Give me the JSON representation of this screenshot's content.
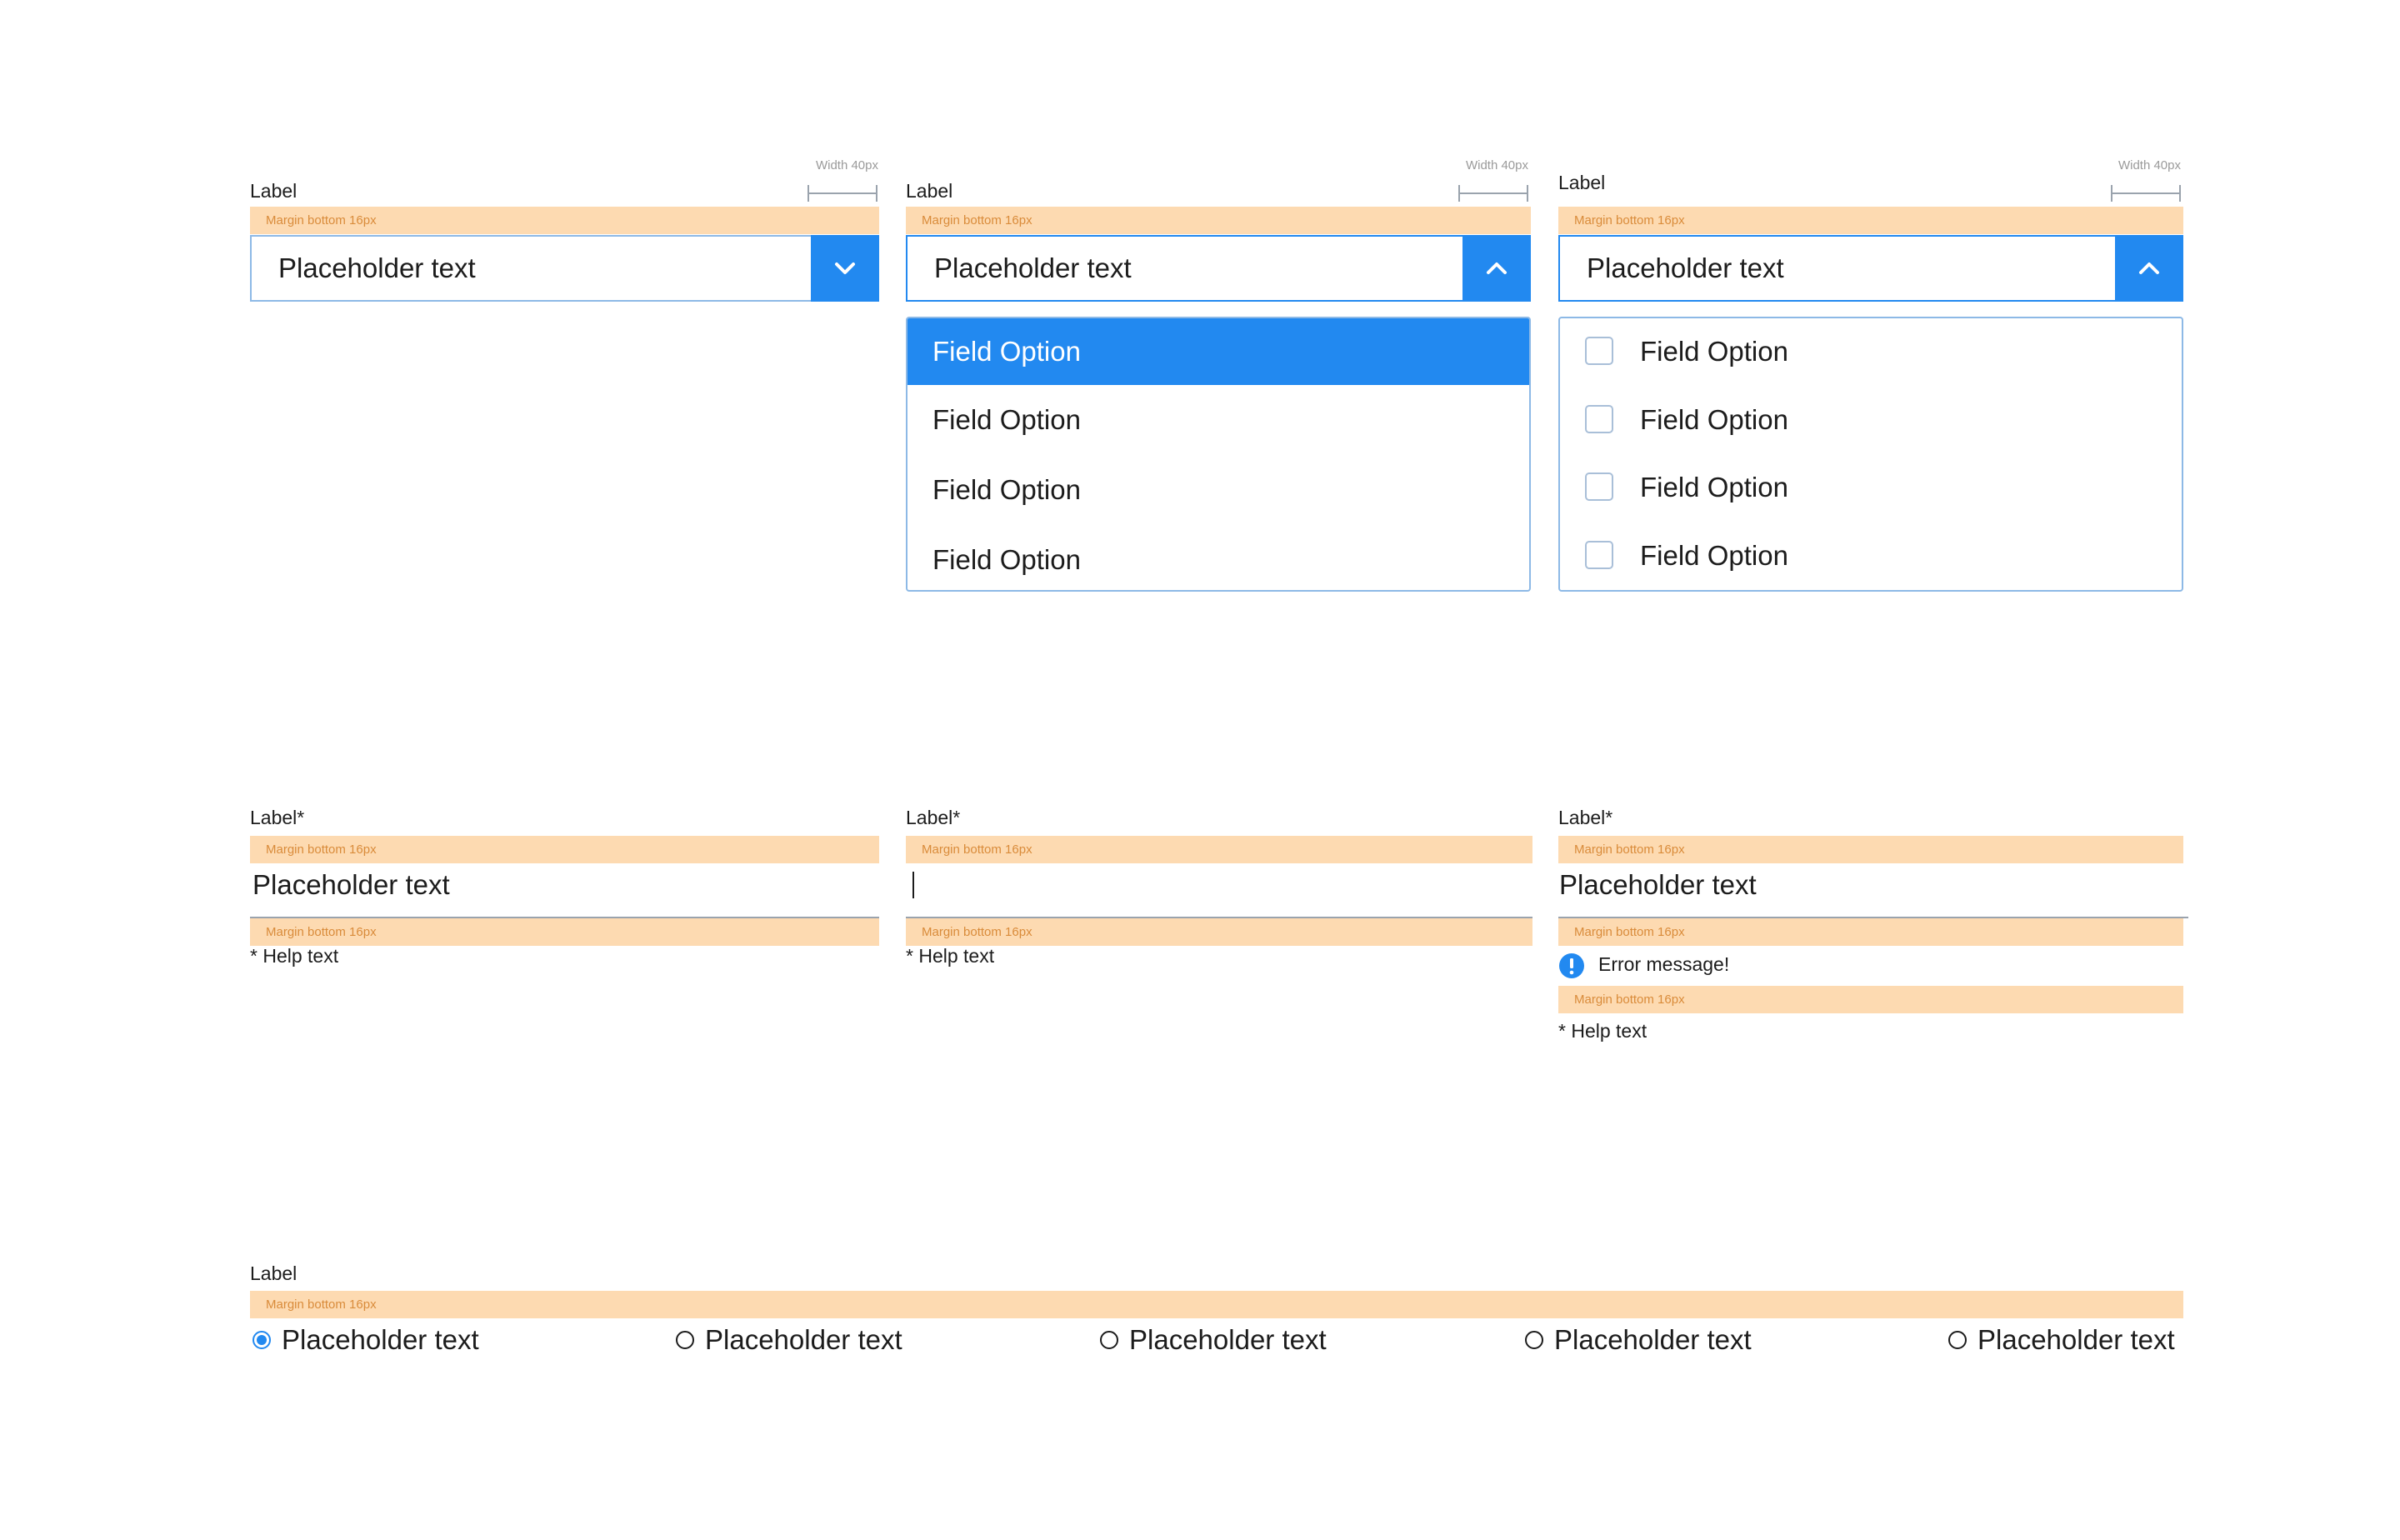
{
  "dropdowns": [
    {
      "label": "Label",
      "margin_note": "Margin bottom  16px",
      "width_note": "Width 40px",
      "placeholder": "Placeholder text",
      "state": "closed",
      "chevron": "chevron-down-icon"
    },
    {
      "label": "Label",
      "margin_note": "Margin bottom  16px",
      "width_note": "Width 40px",
      "placeholder": "Placeholder text",
      "state": "open",
      "chevron": "chevron-up-icon",
      "options": [
        "Field Option",
        "Field Option",
        "Field Option",
        "Field Option"
      ],
      "selected_index": 0
    },
    {
      "label": "Label",
      "margin_note": "Margin bottom  16px",
      "width_note": "Width 40px",
      "placeholder": "Placeholder text",
      "state": "open-multiselect",
      "chevron": "chevron-up-icon",
      "options": [
        "Field Option",
        "Field Option",
        "Field Option",
        "Field Option"
      ]
    }
  ],
  "text_fields": [
    {
      "label": "Label*",
      "margin_note_top": "Margin bottom  16px",
      "value": "Placeholder text",
      "margin_note_bottom": "Margin bottom  16px",
      "help": "* Help text"
    },
    {
      "label": "Label*",
      "margin_note_top": "Margin bottom  16px",
      "value": "",
      "margin_note_bottom": "Margin bottom  16px",
      "help": "* Help text"
    },
    {
      "label": "Label*",
      "margin_note_top": "Margin bottom  16px",
      "value": "Placeholder text",
      "margin_note_bottom": "Margin bottom  16px",
      "error": "Error message!",
      "margin_note_error": "Margin bottom  16px",
      "help": "* Help text"
    }
  ],
  "radio_group": {
    "label": "Label",
    "margin_note": "Margin bottom  16px",
    "options": [
      "Placeholder text",
      "Placeholder text",
      "Placeholder text",
      "Placeholder text",
      "Placeholder text"
    ],
    "selected_index": 0
  },
  "colors": {
    "accent": "#2289f0",
    "margin_band": "#fddab1",
    "margin_band_text": "#d98b3a",
    "border": "#8db9e6"
  }
}
